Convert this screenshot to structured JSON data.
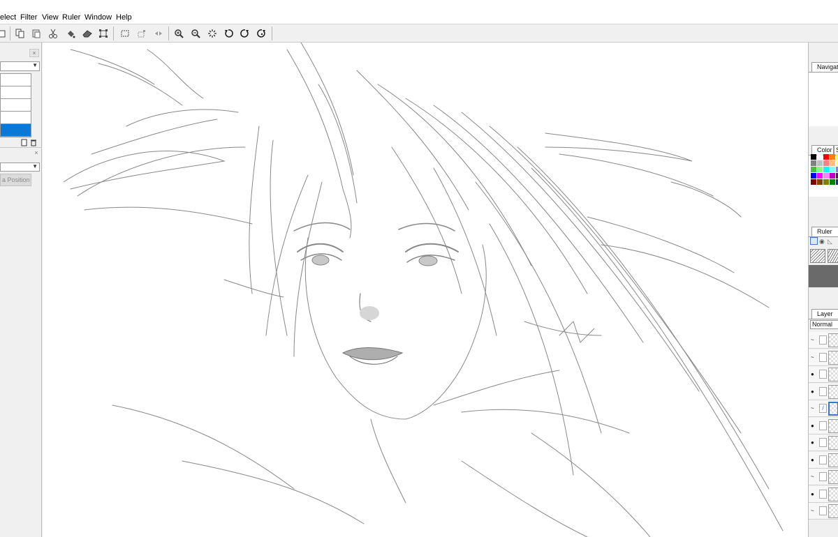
{
  "menu": [
    "elect",
    "Filter",
    "View",
    "Ruler",
    "Window",
    "Help"
  ],
  "toolbar": {
    "buttons": [
      "new-doc",
      "copy",
      "paste",
      "cut",
      "fill",
      "eraser",
      "transform",
      "select-rect",
      "deselect",
      "flip",
      "zoom-in",
      "zoom-out",
      "reset-view",
      "rotate-left",
      "rotate-right",
      "reset-rotation"
    ]
  },
  "left_panel": {
    "close_label": "×",
    "button_label": "a Position"
  },
  "right_panel": {
    "navigator_tab": "Navigato",
    "color_tab": "Color",
    "color_tab2": "S",
    "ruler_tab": "Ruler",
    "layer_tab": "Layer",
    "blend_mode": "Normal",
    "swatch_colors": [
      "#000000",
      "#ffffff",
      "#ff0000",
      "#ff8000",
      "#ffff00",
      "#808080",
      "#c0c0c0",
      "#ff8080",
      "#ffc080",
      "#ffff80",
      "#40c040",
      "#80ff80",
      "#00ffff",
      "#80ffff",
      "#8080ff",
      "#0000ff",
      "#ff00ff",
      "#ff80ff",
      "#c000c0",
      "#800080",
      "#800000",
      "#804000",
      "#808000",
      "#008000",
      "#004080"
    ],
    "layers": [
      {
        "eye": false,
        "selected": false
      },
      {
        "eye": false,
        "selected": false
      },
      {
        "eye": true,
        "selected": false
      },
      {
        "eye": true,
        "selected": false
      },
      {
        "eye": false,
        "selected": true
      },
      {
        "eye": true,
        "selected": false
      },
      {
        "eye": true,
        "selected": false
      },
      {
        "eye": true,
        "selected": false
      },
      {
        "eye": false,
        "selected": false
      },
      {
        "eye": true,
        "selected": false
      },
      {
        "eye": false,
        "selected": false
      }
    ]
  },
  "colors": {
    "selection_blue": "#0a78d7",
    "panel_bg": "#f0f0f0",
    "canvas_bg": "#ffffff",
    "layer_selected": "#3b76c4"
  }
}
